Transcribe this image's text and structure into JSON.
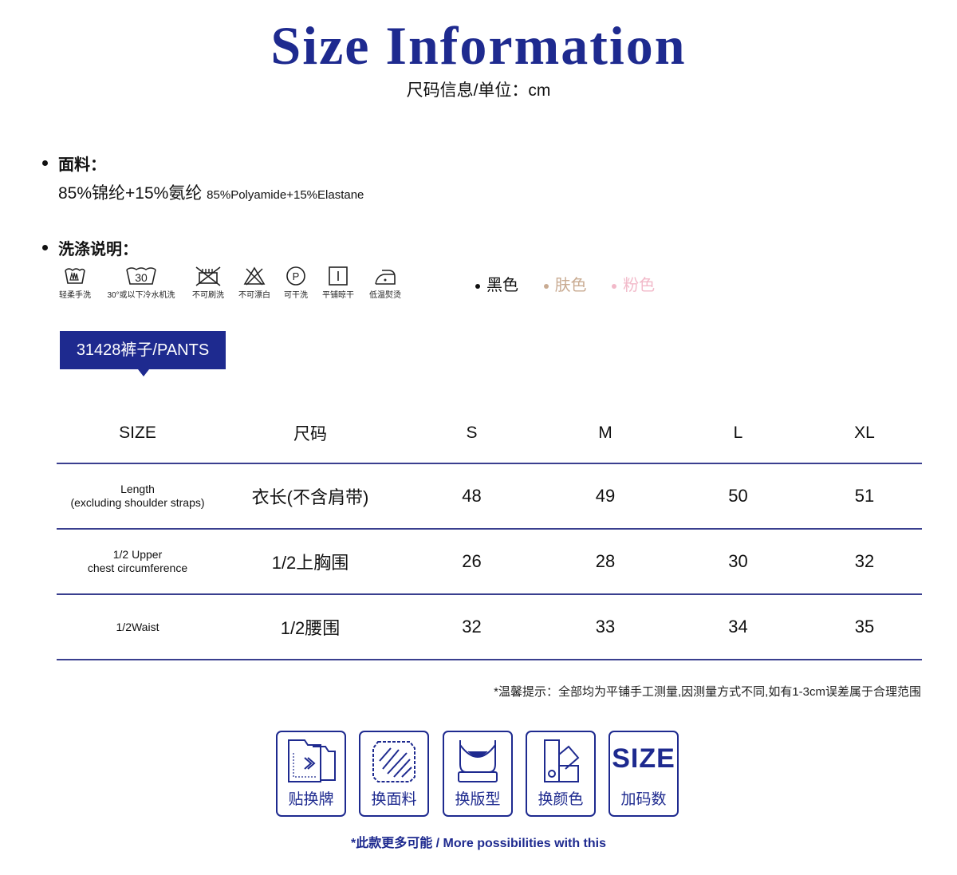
{
  "header": {
    "title": "Size Information",
    "subtitle": "尺码信息/单位：cm"
  },
  "fabric": {
    "label": "面料：",
    "cn": "85%锦纶+15%氨纶",
    "en": "85%Polyamide+15%Elastane"
  },
  "care": {
    "label": "洗涤说明：",
    "items": [
      {
        "icon": "hand-wash-icon",
        "label": "轻柔手洗",
        "symbol": ""
      },
      {
        "icon": "machine-wash-30-icon",
        "label": "30°或以下冷水机洗",
        "symbol": "30"
      },
      {
        "icon": "no-brush-icon",
        "label": "不可刷洗",
        "symbol": ""
      },
      {
        "icon": "no-bleach-icon",
        "label": "不可漂白",
        "symbol": ""
      },
      {
        "icon": "dry-clean-icon",
        "label": "可干洗",
        "symbol": "P"
      },
      {
        "icon": "flat-dry-icon",
        "label": "平铺晾干",
        "symbol": ""
      },
      {
        "icon": "low-iron-icon",
        "label": "低温熨烫",
        "symbol": ""
      }
    ]
  },
  "colors": [
    {
      "name": "黑色",
      "hex": "#111111"
    },
    {
      "name": "肤色",
      "hex": "#c9ab92"
    },
    {
      "name": "粉色",
      "hex": "#f2b9c9"
    }
  ],
  "product_tag": "31428裤子/PANTS",
  "table": {
    "headers": [
      "SIZE",
      "尺码",
      "S",
      "M",
      "L",
      "XL"
    ],
    "rows": [
      {
        "en1": "Length",
        "en2": "(excluding shoulder straps)",
        "cn": "衣长(不含肩带)",
        "values": [
          "48",
          "49",
          "50",
          "51"
        ]
      },
      {
        "en1": "1/2 Upper",
        "en2": "chest circumference",
        "cn": "1/2上胸围",
        "values": [
          "26",
          "28",
          "30",
          "32"
        ]
      },
      {
        "en1": "1/2Waist",
        "en2": "",
        "cn": "1/2腰围",
        "values": [
          "32",
          "33",
          "34",
          "35"
        ]
      }
    ]
  },
  "note": "*温馨提示：全部均为平铺手工测量,因测量方式不同,如有1-3cm误差属于合理范围",
  "features": [
    {
      "icon": "label-swap-icon",
      "label": "贴换牌"
    },
    {
      "icon": "fabric-swap-icon",
      "label": "换面料"
    },
    {
      "icon": "pattern-swap-icon",
      "label": "换版型"
    },
    {
      "icon": "color-swap-icon",
      "label": "换颜色"
    },
    {
      "icon": "size-text-icon",
      "label": "加码数",
      "text": "SIZE"
    }
  ],
  "footer": "*此款更多可能 / More possibilities with this",
  "theme": {
    "accent": "#1e2a8f"
  }
}
